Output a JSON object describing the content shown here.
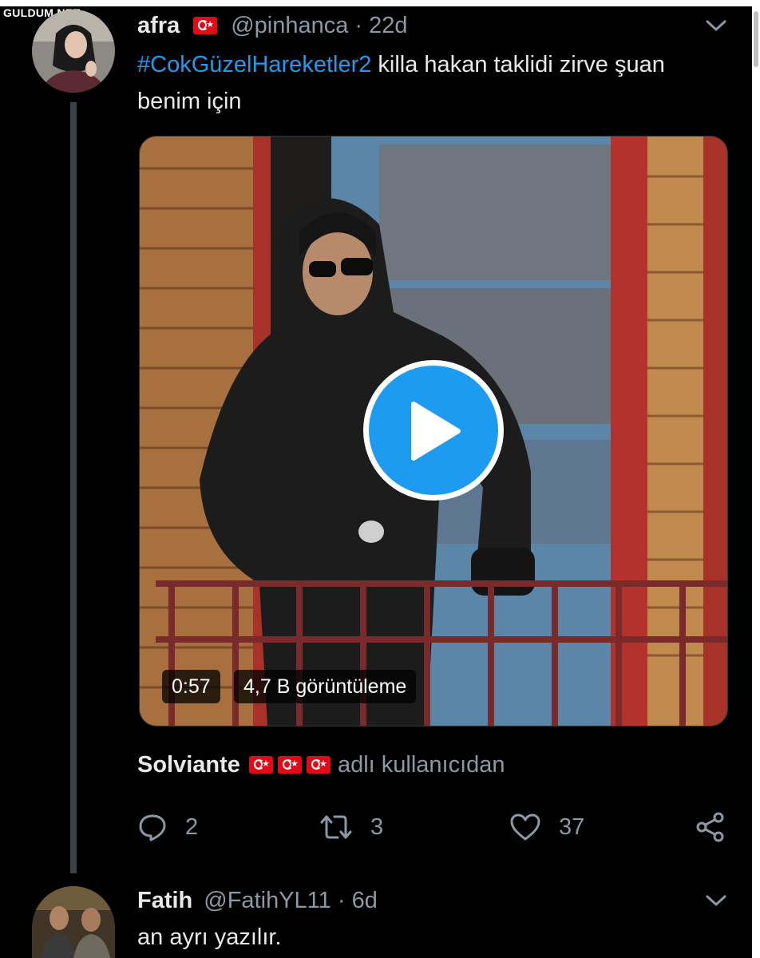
{
  "watermark": "GULDUM.NET",
  "tweet": {
    "author_name": "afra",
    "author_flag_icon": "turkey-flag-icon",
    "handle": "@pinhanca",
    "separator": "·",
    "time": "22d",
    "hashtag": "#CokGüzelHareketler2",
    "text_rest": " killa hakan taklidi zirve şuan benim için",
    "video": {
      "duration": "0:57",
      "views": "4,7 B görüntüleme",
      "play_icon": "play-icon"
    },
    "attribution": {
      "name": "Solviante",
      "flag_count": 3,
      "suffix": "adlı kullanıcıdan"
    },
    "actions": {
      "reply_count": "2",
      "retweet_count": "3",
      "like_count": "37"
    }
  },
  "reply": {
    "author_name": "Fatih",
    "handle": "@FatihYL11",
    "separator": "·",
    "time": "6d",
    "text": "an ayrı yazılır."
  },
  "colors": {
    "background": "#000000",
    "link": "#1d9bf0",
    "muted": "#8b98a5",
    "flag_red": "#e30a17"
  }
}
